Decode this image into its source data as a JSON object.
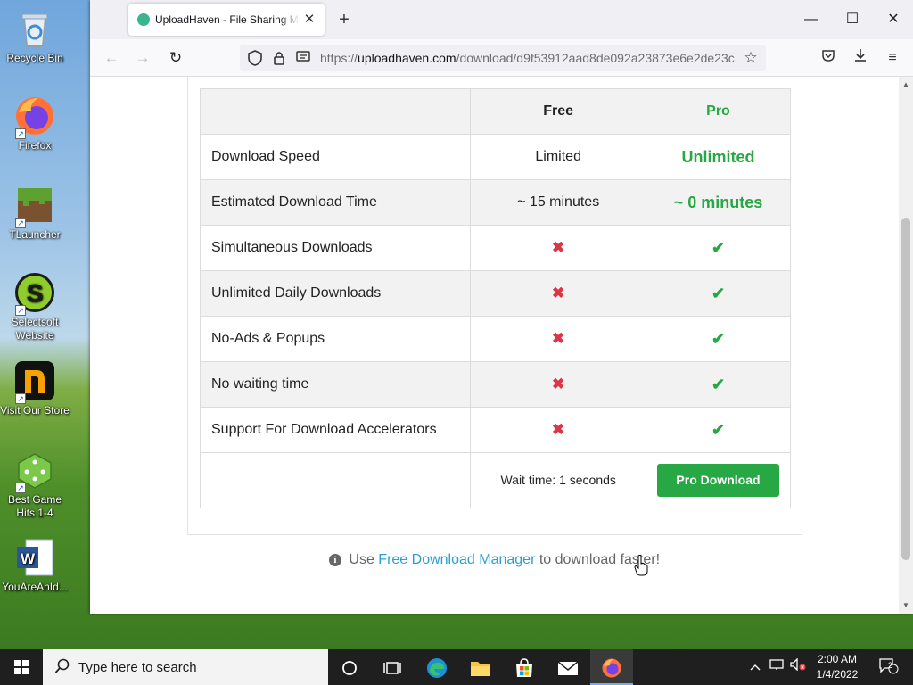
{
  "desktop": {
    "icons": [
      {
        "label": "Recycle Bin",
        "icon": "recycle-bin-icon"
      },
      {
        "label": "Firefox",
        "icon": "firefox-icon"
      },
      {
        "label": "TLauncher",
        "icon": "minecraft-block-icon"
      },
      {
        "label": "Selectsoft Website",
        "icon": "selectsoft-icon"
      },
      {
        "label": "Visit Our Store",
        "icon": "store-icon"
      },
      {
        "label": "Best Game Hits 1-4",
        "icon": "dice-icon"
      },
      {
        "label": "YouAreAnId...",
        "icon": "word-document-icon"
      }
    ]
  },
  "browser": {
    "tab": {
      "title": "UploadHaven - File Sharing Ma",
      "close": "✕"
    },
    "new_tab": "+",
    "window_controls": {
      "minimize": "—",
      "maximize": "☐",
      "close": "✕"
    },
    "nav": {
      "back": "←",
      "forward": "→",
      "reload": "↻"
    },
    "url": {
      "scheme": "https://",
      "host": "uploadhaven.com",
      "path": "/download/d9f53912aad8de092a23873e6e2de23c"
    },
    "icons": {
      "shield": "shield-icon",
      "lock": "lock-icon",
      "reader": "reader-icon",
      "bookmark": "☆",
      "pocket": "pocket-icon",
      "downloads": "download-icon",
      "menu": "≡"
    }
  },
  "comparison": {
    "header": {
      "blank": "",
      "free": "Free",
      "pro": "Pro"
    },
    "rows": [
      {
        "feature": "Download Speed",
        "free": "Limited",
        "pro": "Unlimited"
      },
      {
        "feature": "Estimated Download Time",
        "free": "~ 15 minutes",
        "pro": "~ 0 minutes"
      },
      {
        "feature": "Simultaneous Downloads",
        "free": "✖",
        "pro": "✔"
      },
      {
        "feature": "Unlimited Daily Downloads",
        "free": "✖",
        "pro": "✔"
      },
      {
        "feature": "No-Ads & Popups",
        "free": "✖",
        "pro": "✔"
      },
      {
        "feature": "No waiting time",
        "free": "✖",
        "pro": "✔"
      },
      {
        "feature": "Support For Download Accelerators",
        "free": "✖",
        "pro": "✔"
      }
    ],
    "wait_text": "Wait time: 1 seconds",
    "pro_button": "Pro Download"
  },
  "hint": {
    "prefix": "Use",
    "link": "Free Download Manager",
    "suffix": "to download faster!",
    "info_glyph": "i"
  },
  "colors": {
    "pro_green": "#28a745",
    "cross_red": "#dc3545",
    "link_blue": "#2a9fd6"
  },
  "taskbar": {
    "search_placeholder": "Type here to search",
    "clock_time": "2:00 AM",
    "clock_date": "1/4/2022",
    "notification_count": "2"
  }
}
